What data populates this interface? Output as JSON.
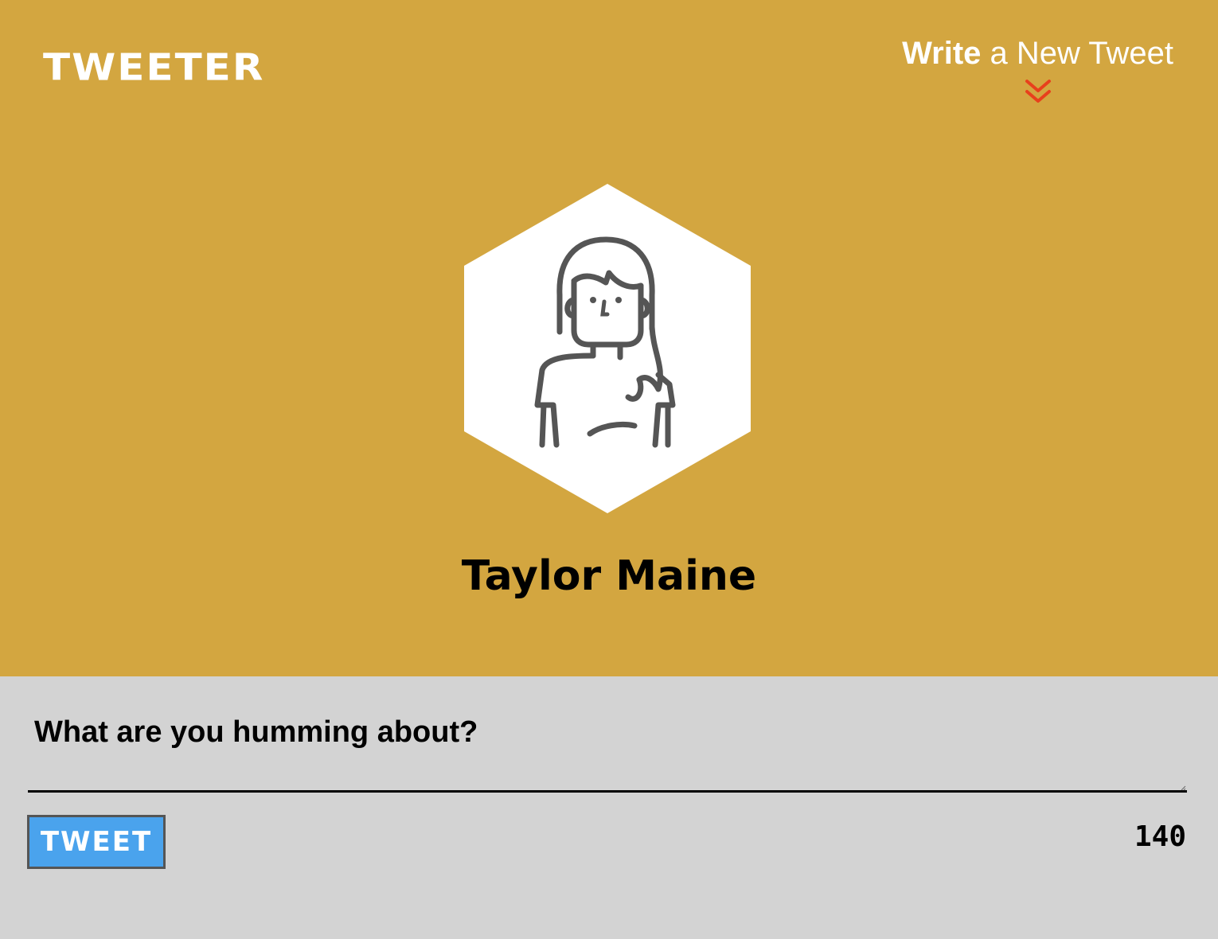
{
  "header": {
    "brand": "TWEETER",
    "compose_toggle": {
      "bold_text": "Write",
      "rest_text": " a New Tweet",
      "icon": "double-chevron-down-icon"
    }
  },
  "profile": {
    "avatar_icon": "woman-avatar-icon",
    "name": "Taylor Maine"
  },
  "composer": {
    "prompt": "What are you humming about?",
    "input_value": "",
    "submit_label": "TWEET",
    "char_count": "140"
  },
  "colors": {
    "hero_background": "#d3a640",
    "composer_background": "#d3d3d3",
    "accent_arrow": "#e8401c",
    "button_background": "#4aa3ed",
    "avatar_line": "#555555"
  }
}
